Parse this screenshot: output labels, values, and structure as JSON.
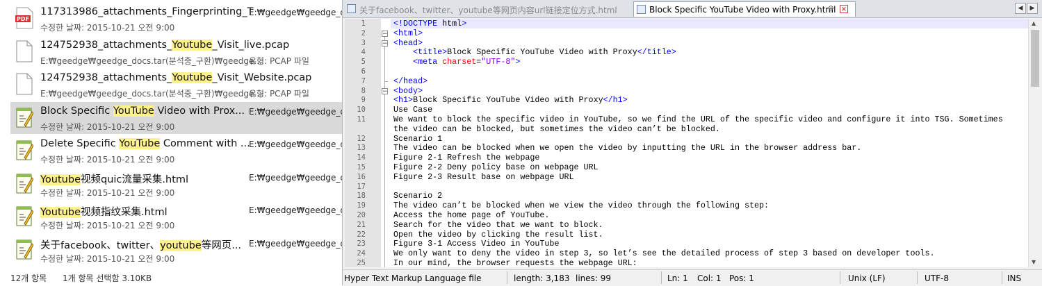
{
  "explorer": {
    "files": [
      {
        "icon": "pdf-file-icon",
        "pre": "117313986_attachments_Fingerprinting_T",
        "hl": "",
        "post": "",
        "sub": "수정한 날짜: 2015-10-21 오전 9:00",
        "loc": "E:₩geedge₩geedge_docs",
        "typ": "",
        "selected": false
      },
      {
        "icon": "generic-file-icon",
        "pre": "124752938_attachments_",
        "hl": "Youtube",
        "post": "_Visit_live.pcap",
        "sub": "E:₩geedge₩geedge_docs.tar(분석중_구환)₩geedge...",
        "loc": "",
        "typ": "유형: PCAP 파일",
        "selected": false
      },
      {
        "icon": "generic-file-icon",
        "pre": "124752938_attachments_",
        "hl": "Youtube",
        "post": "_Visit_Website.pcap",
        "sub": "E:₩geedge₩geedge_docs.tar(분석중_구환)₩geedge...",
        "loc": "",
        "typ": "유형: PCAP 파일",
        "selected": false
      },
      {
        "icon": "notepad-file-icon",
        "pre": "Block Specific ",
        "hl": "YouTube",
        "post": " Video with Prox...",
        "sub": "수정한 날짜: 2015-10-21 오전 9:00",
        "loc": "E:₩geedge₩geedge_docs",
        "typ": "",
        "selected": true
      },
      {
        "icon": "notepad-file-icon",
        "pre": "Delete Specific ",
        "hl": "YouTube",
        "post": " Comment with ...",
        "sub": "수정한 날짜: 2015-10-21 오전 9:00",
        "loc": "E:₩geedge₩geedge_docs",
        "typ": "",
        "selected": false
      },
      {
        "icon": "notepad-file-icon",
        "pre": "",
        "hl": "Youtube",
        "post": "视频quic流量采集.html",
        "sub": "수정한 날짜: 2015-10-21 오전 9:00",
        "loc": "E:₩geedge₩geedge_docs",
        "typ": "",
        "selected": false
      },
      {
        "icon": "notepad-file-icon",
        "pre": "",
        "hl": "Youtube",
        "post": "视频指纹采集.html",
        "sub": "수정한 날짜: 2015-10-21 오전 9:00",
        "loc": "E:₩geedge₩geedge_docs",
        "typ": "",
        "selected": false
      },
      {
        "icon": "notepad-file-icon",
        "pre": "关于facebook、twitter、",
        "hl": "youtube",
        "post": "等网页...",
        "sub": "수정한 날짜: 2015-10-21 오전 9:00",
        "loc": "E:₩geedge₩geedge_docs",
        "typ": "",
        "selected": false
      }
    ],
    "status": {
      "count": "12개 항목",
      "selected": "1개 항목 선택함 3.10KB"
    }
  },
  "editor": {
    "tabs": [
      {
        "label": "关于facebook、twitter、youtube等网页内容url链接定位方式.html",
        "active": false
      },
      {
        "label": "Block Specific YouTube Video with Proxy.html",
        "active": true
      }
    ],
    "lines": [
      {
        "n": "1",
        "t": "<!DOCTYPE html>"
      },
      {
        "n": "2",
        "t": "<html>"
      },
      {
        "n": "3",
        "t": "<head>"
      },
      {
        "n": "4",
        "t": "    <title>Block Specific YouTube Video with Proxy</title>"
      },
      {
        "n": "5",
        "t": "    <meta charset=\"UTF-8\">"
      },
      {
        "n": "6",
        "t": ""
      },
      {
        "n": "7",
        "t": "</head>"
      },
      {
        "n": "8",
        "t": "<body>"
      },
      {
        "n": "9",
        "t": "<h1>Block Specific YouTube Video with Proxy</h1>"
      },
      {
        "n": "10",
        "t": "Use Case"
      },
      {
        "n": "11",
        "t": "We want to block the specific video in YouTube, so we find the URL of the specific video and configure it into TSG. Sometimes"
      },
      {
        "n": "",
        "t": "the video can be blocked, but sometimes the video can’t be blocked."
      },
      {
        "n": "12",
        "t": "Scenario 1"
      },
      {
        "n": "13",
        "t": "The video can be blocked when we open the video by inputting the URL in the browser address bar."
      },
      {
        "n": "14",
        "t": "Figure 2-1 Refresh the webpage"
      },
      {
        "n": "15",
        "t": "Figure 2-2 Deny policy base on webpage URL"
      },
      {
        "n": "16",
        "t": "Figure 2-3 Result base on webpage URL"
      },
      {
        "n": "17",
        "t": ""
      },
      {
        "n": "18",
        "t": "Scenario 2"
      },
      {
        "n": "19",
        "t": "The video can’t be blocked when we view the video through the following step:"
      },
      {
        "n": "20",
        "t": "Access the home page of YouTube."
      },
      {
        "n": "21",
        "t": "Search for the video that we want to block."
      },
      {
        "n": "22",
        "t": "Open the video by clicking the result list."
      },
      {
        "n": "23",
        "t": "Figure 3-1 Access Video in YouTube"
      },
      {
        "n": "24",
        "t": "We only want to deny the video in step 3, so let’s see the detailed process of step 3 based on developer tools."
      },
      {
        "n": "25",
        "t": "In our mind, the browser requests the webpage URL:"
      }
    ],
    "status": {
      "filetype": "Hyper Text Markup Language file",
      "length": "length: 3,183",
      "lines": "lines: 99",
      "ln": "Ln: 1",
      "col": "Col: 1",
      "pos": "Pos: 1",
      "eol": "Unix (LF)",
      "encoding": "UTF-8",
      "mode": "INS"
    },
    "colors": {
      "tag": "#0000ff",
      "attr": "#ff0000",
      "value": "#8000ff",
      "highlight": "#fff28a",
      "selected_row": "#d9d9d9"
    }
  }
}
